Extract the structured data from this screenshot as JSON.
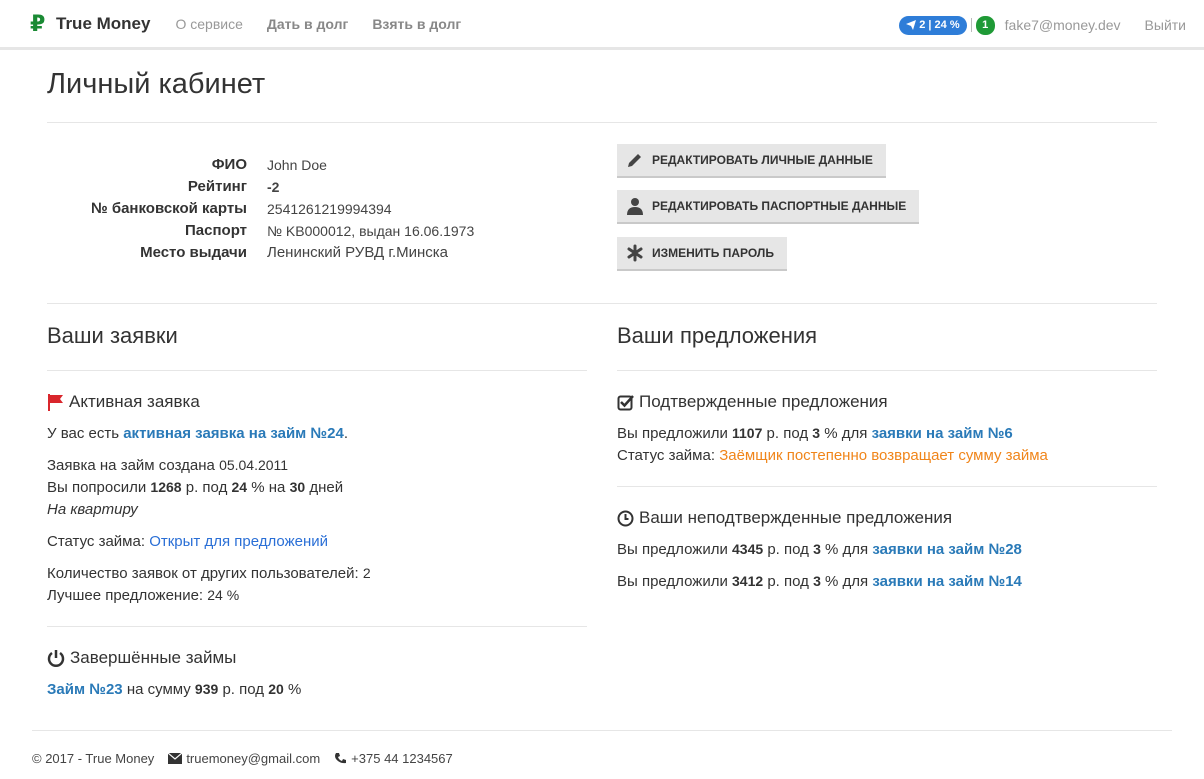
{
  "navbar": {
    "brand_icon": "₽",
    "brand": "True Money",
    "links": [
      "О сервисе",
      "Дать в долг",
      "Взять в долг"
    ],
    "pill": "2 | 24 %",
    "badge": "1",
    "email": "fake7@money.dev",
    "logout": "Выйти"
  },
  "page": {
    "title": "Личный кабинет"
  },
  "profile": {
    "labels": [
      "ФИО",
      "Рейтинг",
      "№ банковской карты",
      "Паспорт",
      "Место выдачи"
    ],
    "name": "John Doe",
    "rating": "-2",
    "card": "2541261219994394",
    "passport": "№ KB000012, выдан 16.06.1973",
    "issued_by": "Ленинский РУВД г.Минска"
  },
  "buttons": {
    "edit_personal": "РЕДАКТИРОВАТЬ ЛИЧНЫЕ ДАННЫЕ",
    "edit_passport": "РЕДАКТИРОВАТЬ ПАСПОРТНЫЕ ДАННЫЕ",
    "change_password": "ИЗМЕНИТЬ ПАРОЛЬ"
  },
  "requests": {
    "title": "Ваши заявки",
    "active_title": "Активная заявка",
    "you_have": "У вас есть",
    "active_link": "активная заявка на займ №24",
    "created": "Заявка на займ создана",
    "created_date": "05.04.2011",
    "asked_prefix": "Вы попросили",
    "asked_amount": "1268",
    "asked_rub": "р. под",
    "asked_rate": "24",
    "asked_pct": "% на",
    "asked_days": "30",
    "asked_days_word": "дней",
    "purpose": "На квартиру",
    "status_label": "Статус займа:",
    "status_value": "Открыт для предложений",
    "count_label": "Количество заявок от других пользователей:",
    "count_value": "2",
    "best_label": "Лучшее предложение:",
    "best_value": "24 %",
    "completed_title": "Завершённые займы",
    "completed_link": "Займ №23",
    "completed_text": "на сумму",
    "completed_amount": "939",
    "completed_rub": "р. под",
    "completed_rate": "20",
    "completed_pct": "%"
  },
  "offers": {
    "title": "Ваши предложения",
    "confirmed_title": "Подтвержденные предложения",
    "confirmed": {
      "prefix": "Вы предложили",
      "amount": "1107",
      "rub": "р. под",
      "rate": "3",
      "pct": "% для",
      "link": "заявки на займ №6",
      "status_label": "Статус займа:",
      "status_value": "Заёмщик постепенно возвращает сумму займа"
    },
    "unconfirmed_title": "Ваши неподтвержденные предложения",
    "unconfirmed": [
      {
        "prefix": "Вы предложили",
        "amount": "4345",
        "rub": "р. под",
        "rate": "3",
        "pct": "% для",
        "link": "заявки на займ №28"
      },
      {
        "prefix": "Вы предложили",
        "amount": "3412",
        "rub": "р. под",
        "rate": "3",
        "pct": "% для",
        "link": "заявки на займ №14"
      }
    ]
  },
  "footer": {
    "copyright": "© 2017 - True Money",
    "email": "truemoney@gmail.com",
    "phone": "+375 44 1234567"
  },
  "colors": {
    "brand_green": "#1a8a34",
    "link_blue": "#2a7ab8",
    "pill_blue": "#2e7dd8",
    "rating_red": "#dd0000",
    "status_orange": "#f0851a"
  }
}
